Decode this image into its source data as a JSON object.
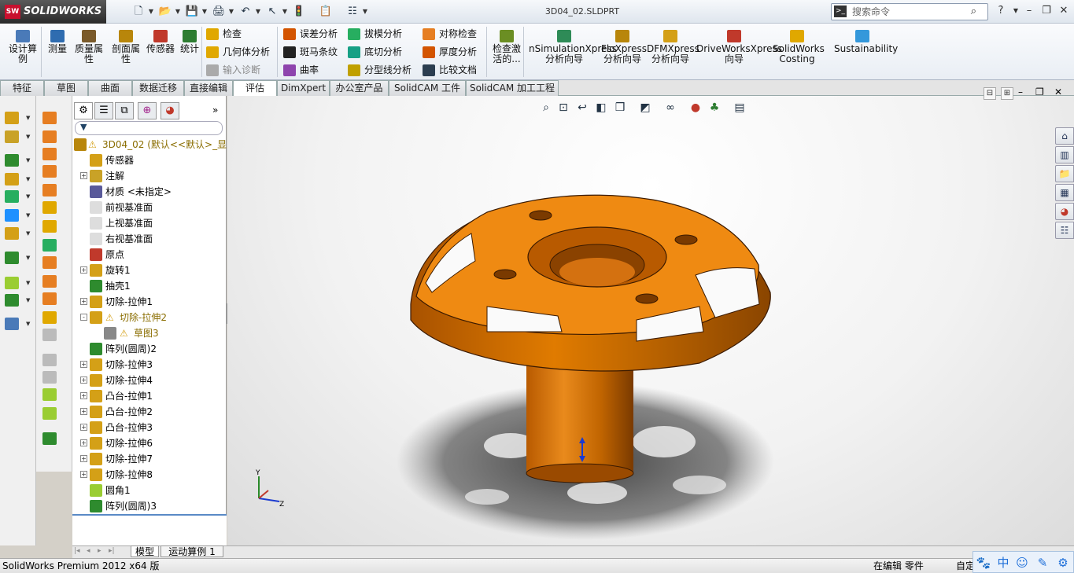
{
  "app": {
    "logo_text": "SOLIDWORKS",
    "logo_mark": "SW",
    "document_title": "3D04_02.SLDPRT",
    "search_placeholder": "搜索命令",
    "search_prompt_icon": ">_",
    "help_label": "?"
  },
  "quick_access": [
    {
      "name": "new-icon",
      "glyph": "🗋"
    },
    {
      "name": "open-icon",
      "glyph": "📂"
    },
    {
      "name": "save-icon",
      "glyph": "💾"
    },
    {
      "name": "print-icon",
      "glyph": "🖨"
    },
    {
      "name": "undo-icon",
      "glyph": "↶"
    },
    {
      "name": "select-icon",
      "glyph": "↖"
    },
    {
      "name": "rebuild-icon",
      "glyph": "🚦"
    },
    {
      "name": "file-properties-icon",
      "glyph": "📋"
    },
    {
      "name": "options-icon",
      "glyph": "☷"
    }
  ],
  "ribbon": {
    "large_buttons": [
      {
        "id": "design-study",
        "label": "设计算例",
        "color": "#4a7ab8"
      },
      {
        "id": "measure",
        "label": "测量",
        "color": "#2f6cb0"
      },
      {
        "id": "mass-properties",
        "label": "质量属性",
        "color": "#7a5a2a"
      },
      {
        "id": "section-properties",
        "label": "剖面属性",
        "color": "#b8860b"
      },
      {
        "id": "sensor",
        "label": "传感器",
        "color": "#c0392b"
      },
      {
        "id": "statistics",
        "label": "统计",
        "color": "#2e7d32"
      }
    ],
    "col1": [
      {
        "id": "check",
        "label": "检查",
        "color": "#e0a800",
        "disabled": false
      },
      {
        "id": "geometry-analysis",
        "label": "几何体分析",
        "color": "#e0a800",
        "disabled": false
      },
      {
        "id": "import-diagnostics",
        "label": "输入诊断",
        "color": "#aaaaaa",
        "disabled": true
      }
    ],
    "col2": [
      {
        "id": "deviation-analysis",
        "label": "误差分析",
        "color": "#d35400"
      },
      {
        "id": "zebra-stripes",
        "label": "斑马条纹",
        "color": "#222222"
      },
      {
        "id": "curvature",
        "label": "曲率",
        "color": "#8e44ad"
      }
    ],
    "col3": [
      {
        "id": "draft-analysis",
        "label": "拔模分析",
        "color": "#27ae60"
      },
      {
        "id": "undercut-analysis",
        "label": "底切分析",
        "color": "#16a085"
      },
      {
        "id": "parting-line-analysis",
        "label": "分型线分析",
        "color": "#c0a000"
      }
    ],
    "col4": [
      {
        "id": "symmetry-check",
        "label": "对称检查",
        "color": "#e67e22"
      },
      {
        "id": "thickness-analysis",
        "label": "厚度分析",
        "color": "#d35400"
      },
      {
        "id": "compare-documents",
        "label": "比较文档",
        "color": "#2c3e50"
      }
    ],
    "large_buttons2": [
      {
        "id": "check-active",
        "label": "检查激活的...",
        "color": "#6b8e23"
      },
      {
        "id": "simulationxpress",
        "label": "nSimulationXpress 分析向导",
        "color": "#2e8b57"
      },
      {
        "id": "floxpress",
        "label": "FloXpress 分析向导",
        "color": "#b8860b"
      },
      {
        "id": "dfmxpress",
        "label": "DFMXpress 分析向导",
        "color": "#d4a017"
      },
      {
        "id": "driveworksxpress",
        "label": "DriveWorksXpress 向导",
        "color": "#c0392b"
      },
      {
        "id": "costing",
        "label": "SolidWorks Costing",
        "color": "#e0a800"
      },
      {
        "id": "sustainability",
        "label": "Sustainability",
        "color": "#3498db"
      }
    ]
  },
  "command_tabs": [
    {
      "label": "特征",
      "active": false
    },
    {
      "label": "草图",
      "active": false
    },
    {
      "label": "曲面",
      "active": false
    },
    {
      "label": "数据迁移",
      "active": false
    },
    {
      "label": "直接编辑",
      "active": false
    },
    {
      "label": "评估",
      "active": true
    },
    {
      "label": "DimXpert",
      "active": false
    },
    {
      "label": "办公室产品",
      "active": false
    },
    {
      "label": "SolidCAM 工件",
      "active": false
    },
    {
      "label": "SolidCAM 加工工程",
      "active": false
    }
  ],
  "feature_tree": {
    "filter_icon": "▼",
    "nodes": [
      {
        "label": "3D04_02  (默认<<默认>_显",
        "level": 0,
        "expand": "",
        "icon": "#b8860b",
        "warn": true
      },
      {
        "label": "传感器",
        "level": 1,
        "expand": "",
        "icon": "#d4a017",
        "warn": false
      },
      {
        "label": "注解",
        "level": 1,
        "expand": "+",
        "icon": "#c9a227",
        "warn": false
      },
      {
        "label": "材质 <未指定>",
        "level": 1,
        "expand": "",
        "icon": "#5a5a9a",
        "warn": false
      },
      {
        "label": "前视基准面",
        "level": 1,
        "expand": "",
        "icon": "#dddddd",
        "warn": false
      },
      {
        "label": "上视基准面",
        "level": 1,
        "expand": "",
        "icon": "#dddddd",
        "warn": false
      },
      {
        "label": "右视基准面",
        "level": 1,
        "expand": "",
        "icon": "#dddddd",
        "warn": false
      },
      {
        "label": "原点",
        "level": 1,
        "expand": "",
        "icon": "#c0392b",
        "warn": false
      },
      {
        "label": "旋转1",
        "level": 1,
        "expand": "+",
        "icon": "#d4a017",
        "warn": false
      },
      {
        "label": "抽壳1",
        "level": 1,
        "expand": "",
        "icon": "#2e8b2e",
        "warn": false
      },
      {
        "label": "切除-拉伸1",
        "level": 1,
        "expand": "+",
        "icon": "#d4a017",
        "warn": false
      },
      {
        "label": "切除-拉伸2",
        "level": 1,
        "expand": "-",
        "icon": "#d4a017",
        "warn": true
      },
      {
        "label": "草图3",
        "level": 2,
        "expand": "",
        "icon": "#888888",
        "warn": true
      },
      {
        "label": "阵列(圆周)2",
        "level": 1,
        "expand": "",
        "icon": "#2e8b2e",
        "warn": false
      },
      {
        "label": "切除-拉伸3",
        "level": 1,
        "expand": "+",
        "icon": "#d4a017",
        "warn": false
      },
      {
        "label": "切除-拉伸4",
        "level": 1,
        "expand": "+",
        "icon": "#d4a017",
        "warn": false
      },
      {
        "label": "凸台-拉伸1",
        "level": 1,
        "expand": "+",
        "icon": "#d4a017",
        "warn": false
      },
      {
        "label": "凸台-拉伸2",
        "level": 1,
        "expand": "+",
        "icon": "#d4a017",
        "warn": false
      },
      {
        "label": "凸台-拉伸3",
        "level": 1,
        "expand": "+",
        "icon": "#d4a017",
        "warn": false
      },
      {
        "label": "切除-拉伸6",
        "level": 1,
        "expand": "+",
        "icon": "#d4a017",
        "warn": false
      },
      {
        "label": "切除-拉伸7",
        "level": 1,
        "expand": "+",
        "icon": "#d4a017",
        "warn": false
      },
      {
        "label": "切除-拉伸8",
        "level": 1,
        "expand": "+",
        "icon": "#d4a017",
        "warn": false
      },
      {
        "label": "圆角1",
        "level": 1,
        "expand": "",
        "icon": "#9acd32",
        "warn": false
      },
      {
        "label": "阵列(圆周)3",
        "level": 1,
        "expand": "",
        "icon": "#2e8b2e",
        "warn": false
      }
    ]
  },
  "bottom_tabs": [
    {
      "label": "模型",
      "active": true
    },
    {
      "label": "运动算例 1",
      "active": false
    }
  ],
  "status": {
    "left": "SolidWorks Premium 2012 x64 版",
    "editing": "在编辑 零件",
    "custom": "自定"
  },
  "triad_labels": {
    "y": "Y",
    "z": "Z"
  },
  "colors": {
    "part": "#e07b00",
    "part_dark": "#8a4500",
    "accent": "#2b579a"
  }
}
